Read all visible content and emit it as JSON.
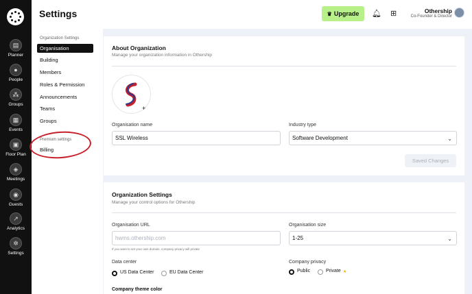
{
  "header": {
    "title": "Settings",
    "upgrade_label": "Upgrade",
    "user_name": "Othership",
    "user_role": "Co-Founder & Director"
  },
  "rail": {
    "items": [
      {
        "label": "Planner",
        "icon": "planner-icon"
      },
      {
        "label": "People",
        "icon": "people-icon"
      },
      {
        "label": "Groups",
        "icon": "groups-icon"
      },
      {
        "label": "Events",
        "icon": "events-icon"
      },
      {
        "label": "Floor Plan",
        "icon": "floor-plan-icon"
      },
      {
        "label": "Meetings",
        "icon": "meetings-icon"
      },
      {
        "label": "Guests",
        "icon": "guests-icon"
      },
      {
        "label": "Analytics",
        "icon": "analytics-icon"
      },
      {
        "label": "Settings",
        "icon": "settings-icon"
      }
    ]
  },
  "nav": {
    "section1": "Organization Settings",
    "items": [
      "Organisation",
      "Building",
      "Members",
      "Roles & Permission",
      "Announcements",
      "Teams",
      "Groups"
    ],
    "active": "Organisation",
    "section2": "Premium settings",
    "premium_items": [
      "Billing"
    ]
  },
  "about": {
    "title": "About Organization",
    "subtitle": "Manage your organization information in Othership",
    "name_label": "Organisation name",
    "name_value": "SSL Wireless",
    "industry_label": "Industry type",
    "industry_value": "Software Development",
    "save_label": "Saved Changes"
  },
  "org_settings": {
    "title": "Organization Settings",
    "subtitle": "Manage your control options for Othership",
    "url_label": "Organisation URL",
    "url_placeholder": "hwms.othership.com",
    "url_hint": "If you want to set your own domain, company privacy will private",
    "size_label": "Organisation size",
    "size_value": "1-25",
    "datacenter_label": "Data center",
    "datacenter_options": [
      "US Data Center",
      "EU Data Center"
    ],
    "datacenter_selected": "US Data Center",
    "privacy_label": "Company privacy",
    "privacy_options": [
      "Public",
      "Private"
    ],
    "privacy_selected": "Public",
    "theme_label": "Company theme color"
  },
  "colors": {
    "upgrade": "#b8f08a",
    "rail": "#111111",
    "annotation": "#c8202a",
    "content_bg": "#eef1f7"
  }
}
